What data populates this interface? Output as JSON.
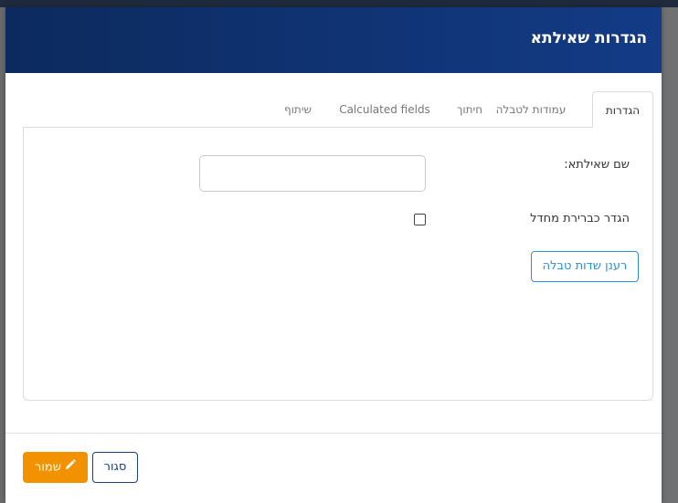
{
  "modal": {
    "title": "הגדרות שאילתא"
  },
  "tabs": [
    {
      "label": "הגדרות",
      "active": true
    },
    {
      "label": "עמודות לטבלה",
      "active": false
    },
    {
      "label": "חיתוך",
      "active": false
    },
    {
      "label": "Calculated fields",
      "active": false
    },
    {
      "label": "שיתוף",
      "active": false
    }
  ],
  "form": {
    "query_name_label": "שם שאילתא:",
    "query_name_value": "",
    "default_label": "הגדר כברירת מחדל",
    "default_checked": false,
    "refresh_button": "רענן שדות טבלה"
  },
  "footer": {
    "save_label": "שמור",
    "close_label": "סגור"
  },
  "icons": {
    "save": "pencil-icon"
  },
  "colors": {
    "header": "#133b86",
    "save": "#f39200",
    "link": "#2f8fd6"
  }
}
